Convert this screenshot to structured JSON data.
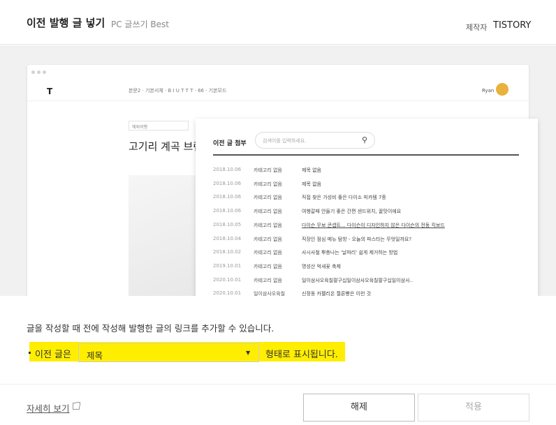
{
  "header": {
    "title": "이전 발행 글 넣기",
    "subtitle": "PC 글쓰기 Best",
    "creator_label": "제작자",
    "creator_name": "TISTORY"
  },
  "preview": {
    "editor": {
      "logo": "T",
      "toolbar": "본문2 · 기본서체 · B I U T T T · 66 · 기본모드",
      "user": "Ryan",
      "category": "해외여행",
      "post_title": "고기리 계곡 브런"
    },
    "popup": {
      "title": "이전 글 첨부",
      "search_placeholder": "검색어를 입력하세요.",
      "rows": [
        {
          "date": "2018.10.06",
          "category": "카테고리 없음",
          "title": "제목 없음"
        },
        {
          "date": "2018.10.06",
          "category": "카테고리 없음",
          "title": "제목 없음"
        },
        {
          "date": "2018.10.06",
          "category": "카테고리 없음",
          "title": "직접 찾은 가성비 좋은 다이소 피카템 7종"
        },
        {
          "date": "2018.10.06",
          "category": "카테고리 없음",
          "title": "여행갈때 안들기 좋은 간편 샌드위치, 꿀맛이에요"
        },
        {
          "date": "2018.10.05",
          "category": "카테고리 없음",
          "title": "다이슨 무보 콘셉트... 다이슨이 디자인하지 않은 다이슨의 전동 킥보드"
        },
        {
          "date": "2018.10.04",
          "category": "카테고리 없음",
          "title": "직장인 점심 메뉴 탐방 - 오늘의 파스타는 무엇일까요?"
        },
        {
          "date": "2018.10.02",
          "category": "카테고리 없음",
          "title": "사시사철 뿌충나는 '날파리' 쉽게 제거하는 방법"
        },
        {
          "date": "2019.10.01",
          "category": "카테고리 없음",
          "title": "명성산 억새꽃 축제"
        },
        {
          "date": "2020.10.01",
          "category": "카테고리 없음",
          "title": "일이삼사오육칠팔구십일이삼사오육칠팔구십일이삼사.."
        },
        {
          "date": "2020.10.01",
          "category": "일이삼사오육칠",
          "title": "신정동 카펠리온 젤론빵은 이런 것"
        }
      ]
    }
  },
  "description": "글을 작성할 때 전에 작성해 발행한 글의 링크를 추가할 수 있습니다.",
  "option": {
    "label": "이전 글은",
    "selected": "제목",
    "suffix": "형태로 표시됩니다."
  },
  "footer": {
    "more_link": "자세히 보기",
    "cancel": "해제",
    "apply": "적용"
  },
  "colors": {
    "highlight": "#ffee00"
  },
  "icons": {
    "search": "magnifier-icon",
    "select_caret": "caret-down-icon",
    "external_link": "external-link-icon"
  }
}
